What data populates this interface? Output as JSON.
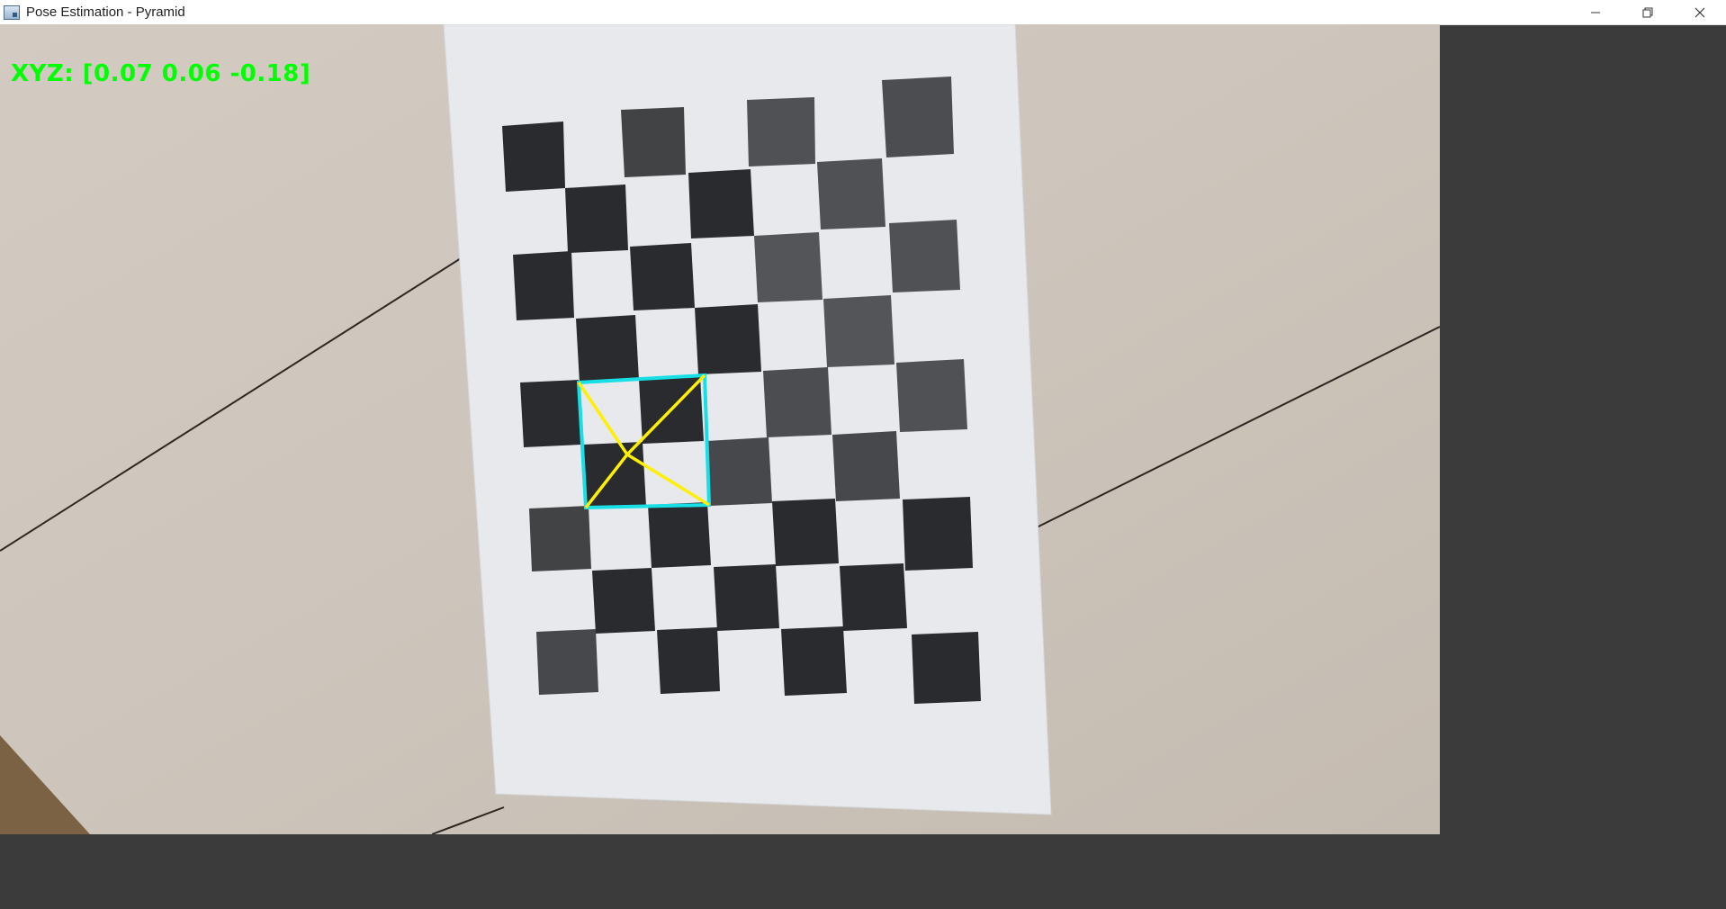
{
  "window": {
    "title": "Pose Estimation - Pyramid",
    "app_icon": "window-app-icon",
    "controls": [
      "minimize-icon",
      "restore-icon",
      "close-icon"
    ]
  },
  "overlay": {
    "xyz_text": "XYZ: [0.07 0.06 -0.18]",
    "xyz_color": "#00ff00"
  },
  "scene": {
    "background_color": "#cfc6bc",
    "paper_color": "#e8eaee",
    "square_color": "#2a2b2e",
    "pyramid_base_color": "#18dfe6",
    "pyramid_edge_color": "#ffef00",
    "frame_color": "#3b3b3b"
  }
}
